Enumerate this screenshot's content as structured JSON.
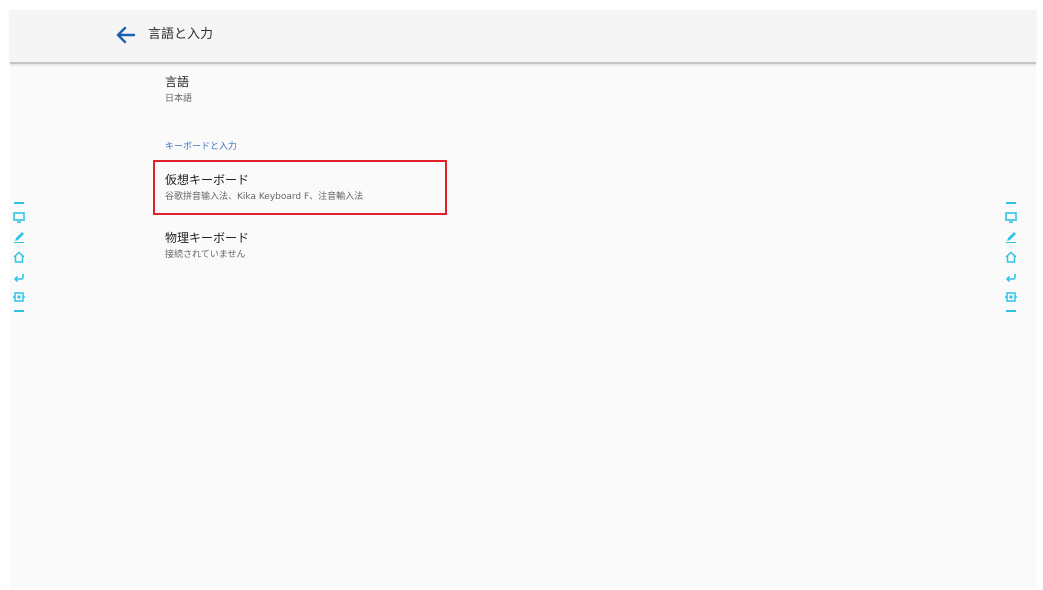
{
  "appbar": {
    "title": "言語と入力"
  },
  "language": {
    "title": "言語",
    "value": "日本語"
  },
  "section": {
    "header": "キーボードと入力"
  },
  "virtual_keyboard": {
    "title": "仮想キーボード",
    "subtitle": "谷歌拼音输入法、Kika Keyboard F、注音輸入法"
  },
  "physical_keyboard": {
    "title": "物理キーボード",
    "subtitle": "接続されていません"
  },
  "side_toolbar": {
    "icons": [
      "screen-icon",
      "pen-icon",
      "home-icon",
      "return-icon",
      "settings-icon"
    ]
  },
  "colors": {
    "accent_blue": "#1a5fb4",
    "section_header": "#3f73c2",
    "side_toolbar": "#31c3e6",
    "highlight_border": "#e0202a"
  }
}
